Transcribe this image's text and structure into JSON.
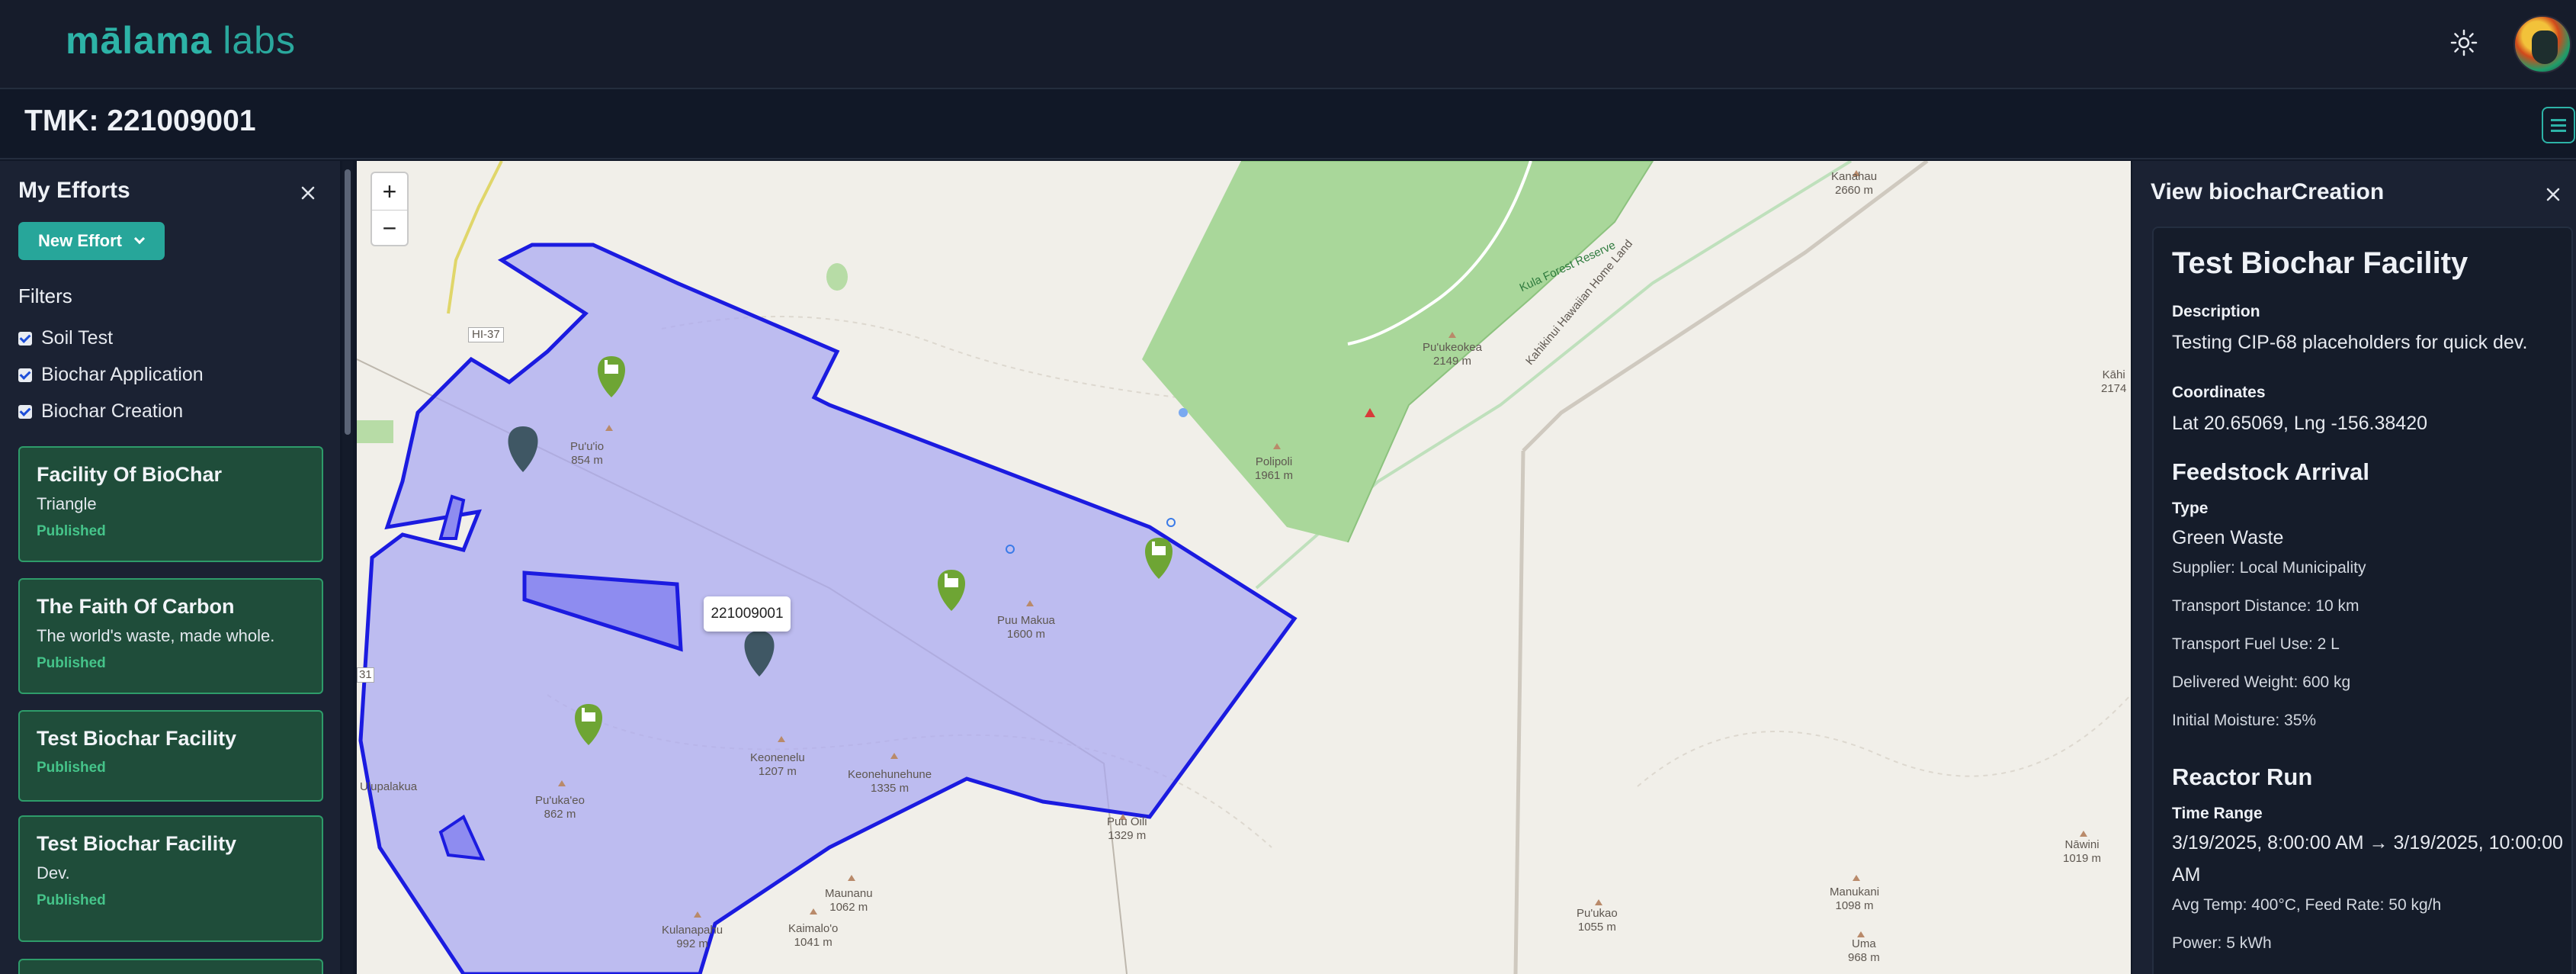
{
  "app": {
    "logo_bold": "mālama",
    "logo_light": "labs"
  },
  "header": {
    "theme_icon": "sun-icon",
    "avatar": "user-avatar"
  },
  "page": {
    "title": "TMK: 221009001"
  },
  "sidebar": {
    "title": "My Efforts",
    "new_effort_label": "New Effort",
    "filters_title": "Filters",
    "filters": [
      {
        "label": "Soil Test",
        "checked": true
      },
      {
        "label": "Biochar Application",
        "checked": true
      },
      {
        "label": "Biochar Creation",
        "checked": true
      }
    ],
    "efforts": [
      {
        "title": "Facility Of BioChar",
        "subtitle": "Triangle",
        "status": "Published"
      },
      {
        "title": "The Faith Of Carbon",
        "subtitle": "The world's waste, made whole.",
        "status": "Published"
      },
      {
        "title": "Test Biochar Facility",
        "subtitle": "",
        "status": "Published"
      },
      {
        "title": "Test Biochar Facility",
        "subtitle": "Dev.",
        "status": "Published"
      }
    ]
  },
  "map": {
    "zoom_in": "+",
    "zoom_out": "−",
    "parcel_label": "221009001",
    "place_labels": [
      {
        "text": "Pu'u'io",
        "sub": "854 m"
      },
      {
        "text": "Puu Makua",
        "sub": "1600 m"
      },
      {
        "text": "Keonenelu",
        "sub": "1207 m"
      },
      {
        "text": "Keonehunehune",
        "sub": "1335 m"
      },
      {
        "text": "Pu'uka'eo",
        "sub": "862 m"
      },
      {
        "text": "Puu Oili",
        "sub": "1329 m"
      },
      {
        "text": "Maunanu",
        "sub": "1062 m"
      },
      {
        "text": "Kaimalo'o",
        "sub": "1041 m"
      },
      {
        "text": "Kulanapahu",
        "sub": "992 m"
      },
      {
        "text": "Ulupalakua",
        "sub": ""
      },
      {
        "text": "Pu'ukao",
        "sub": "1055 m"
      },
      {
        "text": "Manukani",
        "sub": "1098 m"
      },
      {
        "text": "Uma",
        "sub": "968 m"
      },
      {
        "text": "Nāwini",
        "sub": "1019 m"
      },
      {
        "text": "Polipoli",
        "sub": "1961 m"
      },
      {
        "text": "Pu'ukeokea",
        "sub": "2149 m"
      },
      {
        "text": "Kanahau",
        "sub": "2660 m"
      },
      {
        "text": "Kāhi",
        "sub": "2174"
      },
      {
        "text": "Kula Forest Reserve",
        "sub": ""
      },
      {
        "text": "Kahikinui Hawaiian Home Land",
        "sub": ""
      },
      {
        "text": "HI-37",
        "sub": ""
      },
      {
        "text": "31",
        "sub": ""
      }
    ],
    "colors": {
      "parcel_fill": "#a9a8f2",
      "parcel_stroke": "#1b1be0",
      "forest": "#a9d79a",
      "marker_green": "#6ea534",
      "marker_slate": "#3f5764"
    }
  },
  "details": {
    "title": "View biocharCreation",
    "name": "Test Biochar Facility",
    "description_label": "Description",
    "description": "Testing CIP-68 placeholders for quick dev.",
    "coordinates_label": "Coordinates",
    "coordinates": "Lat 20.65069, Lng -156.38420",
    "feedstock": {
      "title": "Feedstock Arrival",
      "type_label": "Type",
      "type": "Green Waste",
      "supplier": "Supplier: Local Municipality",
      "distance": "Transport Distance: 10 km",
      "fuel": "Transport Fuel Use: 2 L",
      "weight": "Delivered Weight: 600 kg",
      "moisture": "Initial Moisture: 35%"
    },
    "reactor": {
      "title": "Reactor Run",
      "time_label": "Time Range",
      "time_line1": "3/19/2025, 8:00:00 AM → 3/19/2025, 10:00:00",
      "time_line2": "AM",
      "temp": "Avg Temp: 400°C, Feed Rate: 50 kg/h",
      "power": "Power: 5 kWh"
    }
  }
}
